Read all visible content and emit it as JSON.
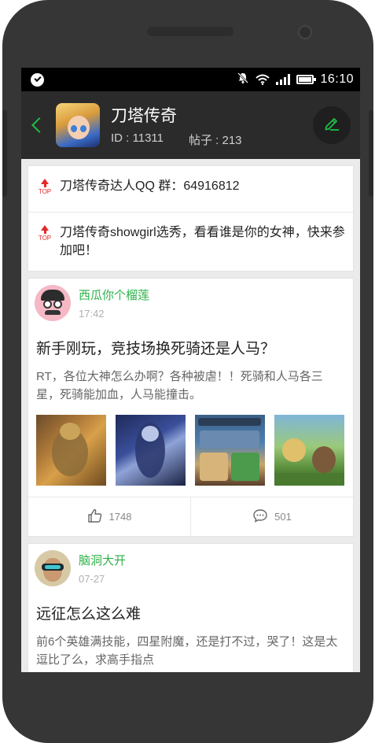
{
  "status_bar": {
    "time": "16:10",
    "icons": [
      "check-circle-icon",
      "bell-off-icon",
      "wifi-icon",
      "signal-icon",
      "battery-icon"
    ]
  },
  "header": {
    "title": "刀塔传奇",
    "id_text": "ID : 11311",
    "posts_text": "帖子 : 213",
    "accent_color": "#1ec144"
  },
  "pinned": [
    {
      "badge": "TOP",
      "text": "刀塔传奇达人QQ 群：64916812"
    },
    {
      "badge": "TOP",
      "text": "刀塔传奇showgirl选秀，看看谁是你的女神，快来参加吧！"
    }
  ],
  "posts": [
    {
      "username": "西瓜你个榴莲",
      "time": "17:42",
      "title": "新手刚玩，竞技场换死骑还是人马？",
      "body": "RT，各位大神怎么办啊？各种被虐！！死骑和人马各三星，死骑能加血，人马能撞击。",
      "likes": "1748",
      "comments": "501"
    },
    {
      "username": "脑洞大开",
      "time": "07-27",
      "title": "远征怎么这么难",
      "body": "前6个英雄满技能，四星附魔，还是打不过，哭了！这是太逗比了么，求高手指点"
    }
  ]
}
